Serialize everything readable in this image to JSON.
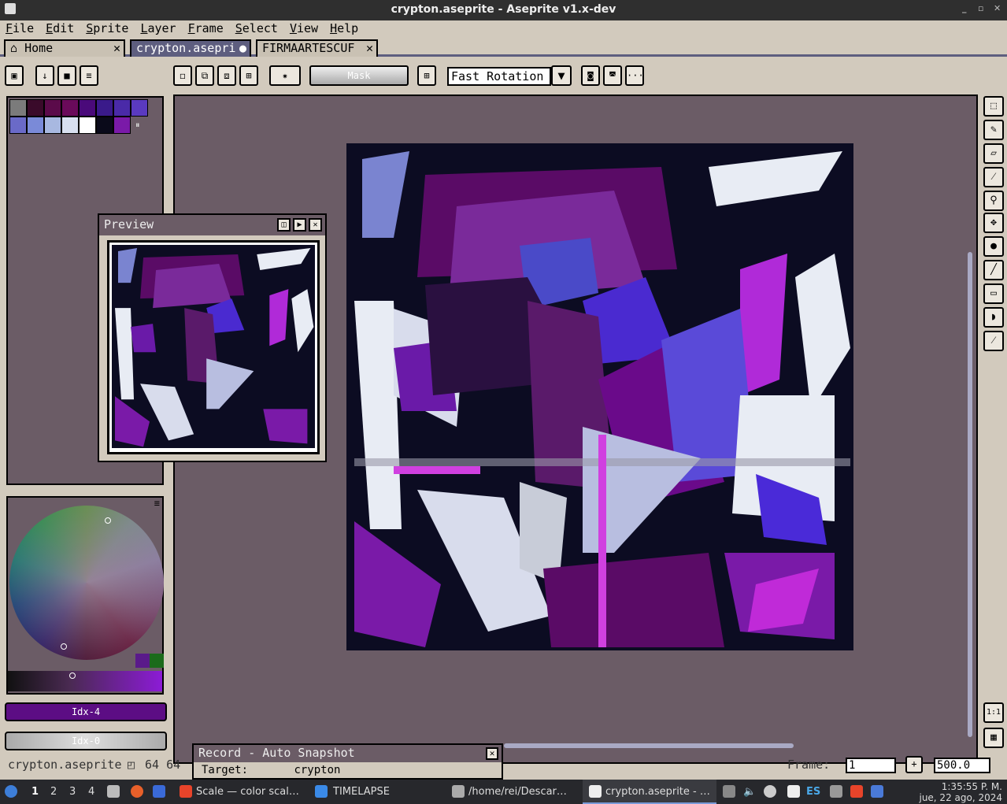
{
  "window": {
    "title": "crypton.aseprite - Aseprite v1.x-dev",
    "min": "_",
    "max": "▫",
    "close": "✕"
  },
  "menu": [
    "File",
    "Edit",
    "Sprite",
    "Layer",
    "Frame",
    "Select",
    "View",
    "Help"
  ],
  "tabs": [
    {
      "label": "Home",
      "close": "✕"
    },
    {
      "label": "crypton.asepri",
      "close": "●"
    },
    {
      "label": "FIRMAARTESCUF",
      "close": "✕"
    }
  ],
  "toolbar": {
    "mask_label": "Mask",
    "rotation_select": "Fast Rotation",
    "more_label": "···"
  },
  "palette": {
    "colors": [
      "#7b7b7b",
      "#3a0a2a",
      "#5b0b4a",
      "#6a0a5a",
      "#4a0a7a",
      "#3a1a8a",
      "#4a2aa8",
      "#5a3ac0",
      "#6a6ac8",
      "#7a8ad8",
      "#a8b8e0",
      "#d8e0f0",
      "#ffffff",
      "#0a0a1a",
      "#7a1aa8"
    ],
    "marker": "⏸"
  },
  "color_wheel": {
    "menu_icon": "≡"
  },
  "fg_color": {
    "label": "Idx-4",
    "color": "#5c0d84"
  },
  "bg_color": {
    "label": "Idx-0"
  },
  "preview": {
    "title": "Preview"
  },
  "record": {
    "title": "Record - Auto Snapshot",
    "target_label": "Target:",
    "target_value": "crypton"
  },
  "status": {
    "filename": "crypton.aseprite",
    "size": "64 64",
    "frame_label": "Frame:",
    "frame_value": "1",
    "plus": "+",
    "zoom": "500.0"
  },
  "right_tools": [
    "rectangular-marquee",
    "pencil",
    "eraser",
    "eyedropper",
    "zoom",
    "move",
    "paint-bucket",
    "line",
    "rectangle",
    "contour",
    "blur"
  ],
  "taskbar": {
    "workspaces": [
      "1",
      "2",
      "3",
      "4"
    ],
    "tasks": [
      {
        "label": "Scale — color scal…"
      },
      {
        "label": "TIMELAPSE"
      },
      {
        "label": "/home/rei/Descar…"
      },
      {
        "label": "crypton.aseprite - …"
      }
    ],
    "lang": "ES",
    "time": "1:35:55 P. M.",
    "date": "jue, 22 ago, 2024"
  }
}
